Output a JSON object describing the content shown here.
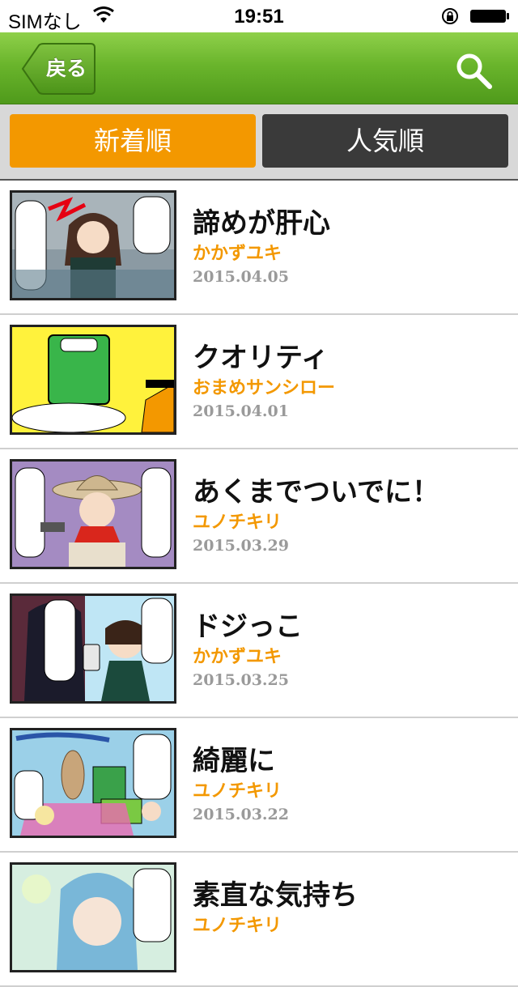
{
  "status_bar": {
    "carrier": "SIMなし",
    "time": "19:51"
  },
  "nav": {
    "back_label": "戻る",
    "search_icon": "search-icon"
  },
  "tabs": {
    "new_label": "新着順",
    "popular_label": "人気順",
    "active": "new"
  },
  "colors": {
    "accent_orange": "#f39800",
    "nav_green": "#6ab52c",
    "tab_dark": "#3a3a3a",
    "date_gray": "#9a9a9a"
  },
  "items": [
    {
      "title": "諦めが肝心",
      "author": "かかずユキ",
      "date": "2015.04.05"
    },
    {
      "title": "クオリティ",
      "author": "おまめサンシロー",
      "date": "2015.04.01"
    },
    {
      "title": "あくまでついでに！",
      "author": "ユノチキリ",
      "date": "2015.03.29"
    },
    {
      "title": "ドジっこ",
      "author": "かかずユキ",
      "date": "2015.03.25"
    },
    {
      "title": "綺麗に",
      "author": "ユノチキリ",
      "date": "2015.03.22"
    },
    {
      "title": "素直な気持ち",
      "author": "ユノチキリ",
      "date": ""
    }
  ]
}
